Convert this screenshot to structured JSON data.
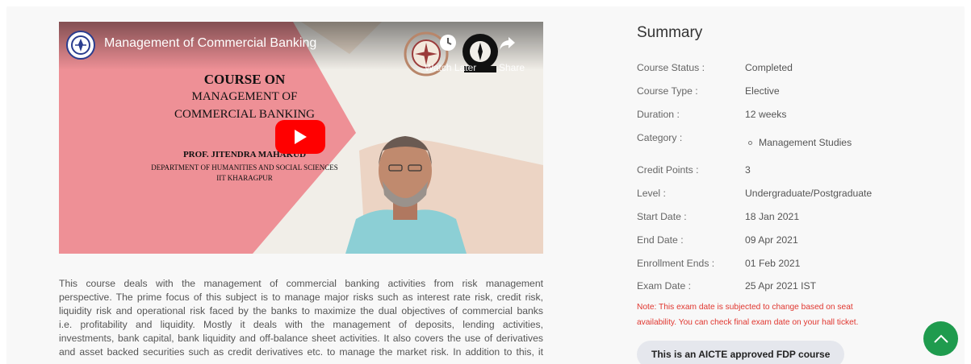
{
  "video": {
    "title": "Management of Commercial Banking",
    "watch_later_label": "Watch Later",
    "share_label": "Share",
    "slide": {
      "line1": "COURSE ON",
      "line2": "MANAGEMENT OF",
      "line3": "COMMERCIAL BANKING",
      "professor": "PROF. JITENDRA MAHAKUD",
      "department": "DEPARTMENT OF HUMANITIES AND SOCIAL SCIENCES",
      "institute": "IIT KHARAGPUR"
    },
    "colors": {
      "play": "#ff0000",
      "pink": "#ee9096",
      "beige": "#ecd4c4"
    }
  },
  "description": {
    "lines": [
      "This course deals with the management of commercial banking activities from risk management",
      "perspective. The prime focus of this subject is to manage major risks such as interest rate risk, credit risk,",
      "liquidity risk and operational risk faced by the banks to maximize the dual objectives of commercial banks",
      "i.e. profitability and liquidity. Mostly it deals with the management of deposits, lending activities,",
      "investments, bank capital, bank liquidity and off-balance sheet activities. It also covers the use of derivatives",
      "and asset backed securities such as credit derivatives etc. to manage the market risk. In addition to this, it"
    ]
  },
  "summary": {
    "title": "Summary",
    "rows": [
      {
        "label": "Course Status :",
        "value": "Completed"
      },
      {
        "label": "Course Type :",
        "value": "Elective"
      },
      {
        "label": "Duration :",
        "value": "12 weeks"
      },
      {
        "label": "Category :",
        "value": "Management Studies"
      },
      {
        "label": "Credit Points :",
        "value": "3"
      },
      {
        "label": "Level :",
        "value": "Undergraduate/Postgraduate"
      },
      {
        "label": "Start Date :",
        "value": "18 Jan 2021"
      },
      {
        "label": "End Date :",
        "value": "09 Apr 2021"
      },
      {
        "label": "Enrollment Ends :",
        "value": "01 Feb 2021"
      },
      {
        "label": "Exam Date :",
        "value": "25 Apr 2021 IST"
      }
    ],
    "note_line1": "Note: This exam date is subjected to change based on seat",
    "note_line2": "availability. You can check final exam date on your hall ticket.",
    "fdp_badge": "This is an AICTE approved FDP course",
    "note_color": "#e0362f",
    "accent_green": "#1f9b4e"
  },
  "icons": {
    "scroll_top": "chevron-up-icon",
    "watch_later": "clock-icon",
    "share": "share-arrow-icon",
    "play": "play-icon"
  }
}
